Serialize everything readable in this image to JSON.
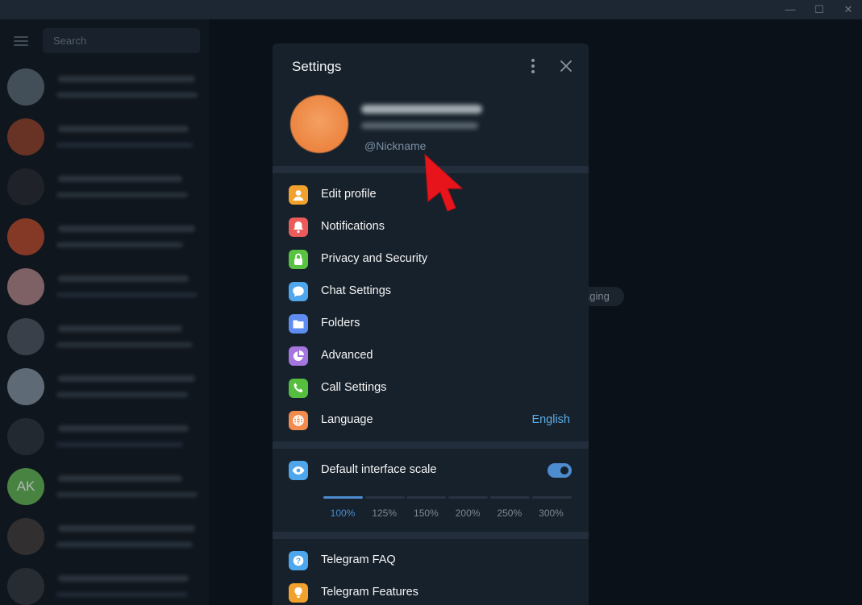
{
  "window": {
    "minimize": "—",
    "maximize": "☐",
    "close": "✕"
  },
  "sidebar": {
    "search_placeholder": "Search",
    "chats": [
      {
        "avatar_icon": "photo-avatar-icon",
        "avatar_color": "#6b7f8a"
      },
      {
        "avatar_icon": "photo-avatar-icon",
        "avatar_color": "#b04a2c"
      },
      {
        "avatar_icon": "python-logo-icon",
        "avatar_color": "#2c2f33"
      },
      {
        "avatar_icon": "orange-app-icon",
        "avatar_color": "#e4572e"
      },
      {
        "avatar_icon": "red-chart-icon",
        "avatar_color": "#d8a0a0"
      },
      {
        "avatar_icon": "photo-avatar-icon",
        "avatar_color": "#5b6570"
      },
      {
        "avatar_icon": "books-icon",
        "avatar_color": "#9fb0c0"
      },
      {
        "avatar_icon": "photo-avatar-icon",
        "avatar_color": "#333a40"
      },
      {
        "avatar_initials": "AK",
        "avatar_color": "#5ba84d"
      },
      {
        "avatar_icon": "photo-avatar-icon",
        "avatar_color": "#4e4540"
      },
      {
        "avatar_icon": "photo-avatar-icon",
        "avatar_color": "#3a3f44"
      }
    ]
  },
  "background": {
    "pill_text": "aging"
  },
  "settings": {
    "title": "Settings",
    "profile": {
      "nickname": "@Nickname"
    },
    "menu": [
      {
        "label": "Edit profile",
        "icon": "user-icon",
        "color": "#f1a12c"
      },
      {
        "label": "Notifications",
        "icon": "bell-icon",
        "color": "#ec5b5b"
      },
      {
        "label": "Privacy and Security",
        "icon": "lock-icon",
        "color": "#58c241"
      },
      {
        "label": "Chat Settings",
        "icon": "chat-bubble-icon",
        "color": "#4ea6ed"
      },
      {
        "label": "Folders",
        "icon": "folder-icon",
        "color": "#5e8cf1"
      },
      {
        "label": "Advanced",
        "icon": "pie-chart-icon",
        "color": "#a675e0"
      },
      {
        "label": "Call Settings",
        "icon": "phone-icon",
        "color": "#55be3f"
      },
      {
        "label": "Language",
        "icon": "globe-icon",
        "color": "#f28b4c",
        "value": "English"
      }
    ],
    "scale": {
      "label": "Default interface scale",
      "icon": "eye-icon",
      "color": "#4ea6ed",
      "toggle_on": true,
      "options": [
        "100%",
        "125%",
        "150%",
        "200%",
        "250%",
        "300%"
      ],
      "selected": "100%",
      "accent": "#4c8ccf"
    },
    "help": [
      {
        "label": "Telegram FAQ",
        "icon": "question-icon",
        "color": "#4ea6ed"
      },
      {
        "label": "Telegram Features",
        "icon": "lightbulb-icon",
        "color": "#f1a12c"
      }
    ]
  }
}
